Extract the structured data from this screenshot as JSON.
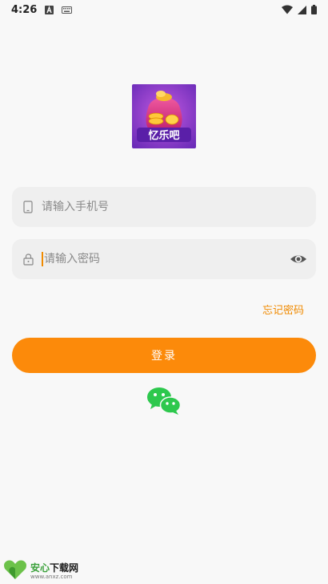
{
  "status_bar": {
    "time": "4:26"
  },
  "login": {
    "phone_placeholder": "请输入手机号",
    "password_placeholder": "请输入密码",
    "forgot_label": "忘记密码",
    "submit_label": "登录"
  },
  "logo": {
    "text": "忆乐吧"
  },
  "watermark": {
    "brand_green": "安心",
    "brand_rest": "下载网",
    "url": "www.anxz.com"
  },
  "colors": {
    "accent": "#fc8a0a",
    "background": "#f8f8f8",
    "field": "#efefef",
    "wechat": "#2dc84d"
  },
  "icons": {
    "phone": "phone-icon",
    "lock": "lock-icon",
    "eye": "eye-icon",
    "wechat": "wechat-icon"
  }
}
